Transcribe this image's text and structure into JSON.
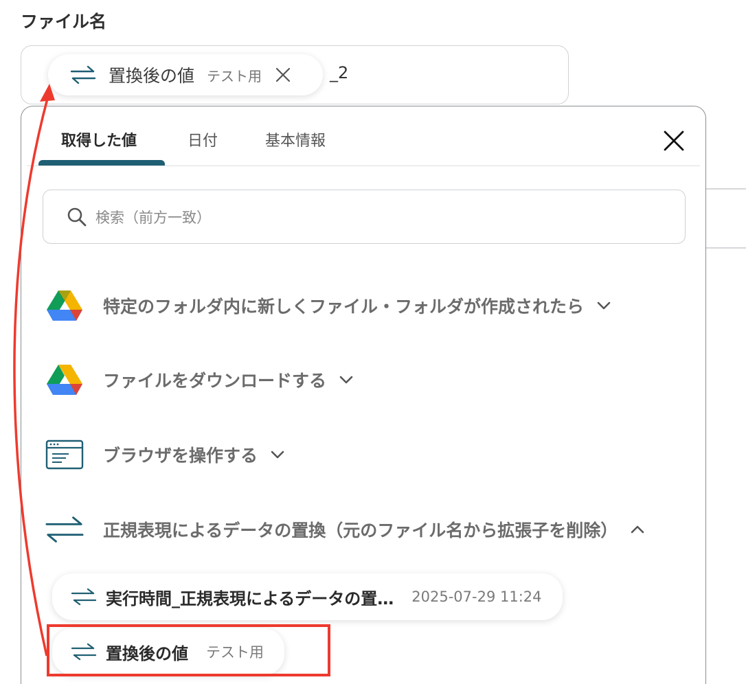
{
  "field": {
    "label": "ファイル名",
    "suffix": "_2"
  },
  "selected_chip": {
    "label": "置換後の値",
    "sub": "テスト用",
    "icon": "swap-arrows-icon"
  },
  "panel": {
    "tabs": [
      {
        "label": "取得した値",
        "active": true
      },
      {
        "label": "日付",
        "active": false
      },
      {
        "label": "基本情報",
        "active": false
      }
    ],
    "search_placeholder": "検索（前方一致）",
    "sections": [
      {
        "label": "特定のフォルダ内に新しくファイル・フォルダが作成されたら",
        "icon": "google-drive-icon",
        "expanded": false
      },
      {
        "label": "ファイルをダウンロードする",
        "icon": "google-drive-icon",
        "expanded": false
      },
      {
        "label": "ブラウザを操作する",
        "icon": "browser-window-icon",
        "expanded": false
      },
      {
        "label": "正規表現によるデータの置換（元のファイル名から拡張子を削除）",
        "icon": "swap-arrows-icon",
        "expanded": true
      }
    ],
    "items": [
      {
        "label": "実行時間_正規表現によるデータの置…",
        "sub": "2025-07-29 11:24"
      },
      {
        "label": "置換後の値",
        "sub": "テスト用"
      }
    ]
  },
  "colors": {
    "accent": "#1f5f73",
    "annotation": "#ee3a2e"
  }
}
